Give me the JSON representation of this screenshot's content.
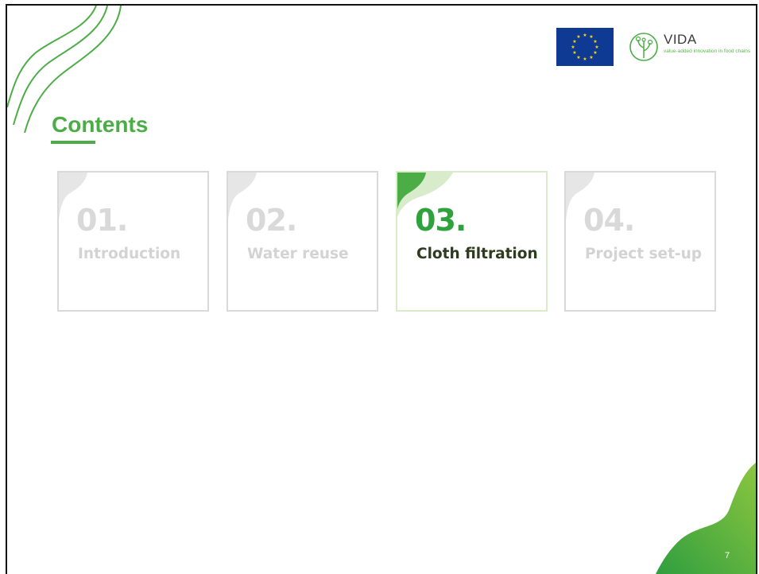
{
  "slide": {
    "title": "Contents",
    "page_number": "7"
  },
  "logos": {
    "eu_flag": "eu-flag",
    "vida_name": "VIDA",
    "vida_tagline": "value-added innovation in food chains"
  },
  "cards": [
    {
      "number": "01.",
      "label": "Introduction",
      "active": false
    },
    {
      "number": "02.",
      "label": "Water reuse",
      "active": false
    },
    {
      "number": "03.",
      "label": "Cloth filtration",
      "active": true
    },
    {
      "number": "04.",
      "label": "Project set-up",
      "active": false
    }
  ],
  "colors": {
    "accent": "#4cad47",
    "active_number": "#2fa23e",
    "active_label": "#2f3b1e",
    "inactive": "#d9d9d9",
    "eu_blue": "#0f3a93",
    "eu_star": "#ffdd00"
  }
}
